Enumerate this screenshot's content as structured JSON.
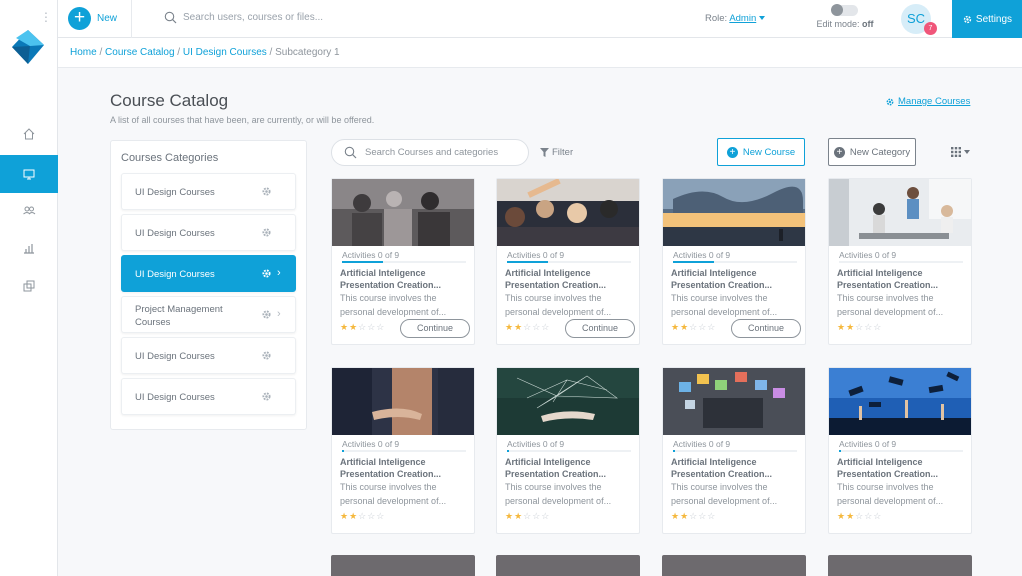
{
  "topbar": {
    "new_label": "New",
    "search_placeholder": "Search users, courses or files...",
    "role_label": "Role:",
    "role_value": "Admin",
    "edit_mode_label": "Edit mode:",
    "edit_mode_value": "off",
    "avatar_initials": "SC",
    "notification_count": "7",
    "settings_label": "Settings"
  },
  "breadcrumb": {
    "items": [
      "Home",
      "Course Catalog",
      "UI Design Courses"
    ],
    "current": "Subcategory 1",
    "separator": " / "
  },
  "header": {
    "title": "Course Catalog",
    "subtitle": "A list of all courses that have been, are currently, or will be offered.",
    "manage_link": "Manage Courses"
  },
  "categories": {
    "heading": "Courses Categories",
    "items": [
      {
        "label": "UI Design Courses",
        "active": false
      },
      {
        "label": "UI Design Courses",
        "active": false
      },
      {
        "label": "UI Design Courses",
        "active": true
      },
      {
        "label": "Project Management Courses",
        "active": false
      },
      {
        "label": "UI Design Courses",
        "active": false
      },
      {
        "label": "UI Design Courses",
        "active": false
      }
    ]
  },
  "toolbar": {
    "search_placeholder": "Search Courses and categories",
    "filter_label": "Filter",
    "new_course_label": "New Course",
    "new_category_label": "New Category"
  },
  "courses": [
    {
      "activities": "Activities 0 of 9",
      "progress": 0.33,
      "title": "Artificial Inteligence Presentation Creation...",
      "desc": "This course involves the personal development of...",
      "rating": 2,
      "action": "Continue",
      "image": "team-meeting-photo"
    },
    {
      "activities": "Activities 0 of 9",
      "progress": 0.33,
      "title": "Artificial Inteligence Presentation Creation...",
      "desc": "This course involves the personal development of...",
      "rating": 2,
      "action": "Continue",
      "image": "audience-photo"
    },
    {
      "activities": "Activities 0 of 9",
      "progress": 0.33,
      "title": "Artificial Inteligence Presentation Creation...",
      "desc": "This course involves the personal development of...",
      "rating": 2,
      "action": "Continue",
      "image": "world-map-sunset-photo"
    },
    {
      "activities": "Activities 0 of 9",
      "progress": 0.0,
      "title": "Artificial Inteligence Presentation Creation...",
      "desc": "This course involves the personal development of...",
      "rating": 2,
      "action": "",
      "image": "office-presentation-photo"
    },
    {
      "activities": "Activities 0 of 9",
      "progress": 0.0,
      "title": "Artificial Inteligence Presentation Creation...",
      "desc": "This course involves the personal development of...",
      "rating": 2,
      "action": "",
      "image": "handshake-photo"
    },
    {
      "activities": "Activities 0 of 9",
      "progress": 0.0,
      "title": "Artificial Inteligence Presentation Creation...",
      "desc": "This course involves the personal development of...",
      "rating": 2,
      "action": "",
      "image": "network-hand-photo"
    },
    {
      "activities": "Activities 0 of 9",
      "progress": 0.0,
      "title": "Artificial Inteligence Presentation Creation...",
      "desc": "This course involves the personal development of...",
      "rating": 2,
      "action": "",
      "image": "tablet-icons-photo"
    },
    {
      "activities": "Activities 0 of 9",
      "progress": 0.0,
      "title": "Artificial Inteligence Presentation Creation...",
      "desc": "This course involves the personal development of...",
      "rating": 2,
      "action": "",
      "image": "graduation-caps-photo"
    }
  ],
  "colors": {
    "accent": "#0fa1d8",
    "star": "#f5b83d",
    "badge": "#f0567a"
  }
}
